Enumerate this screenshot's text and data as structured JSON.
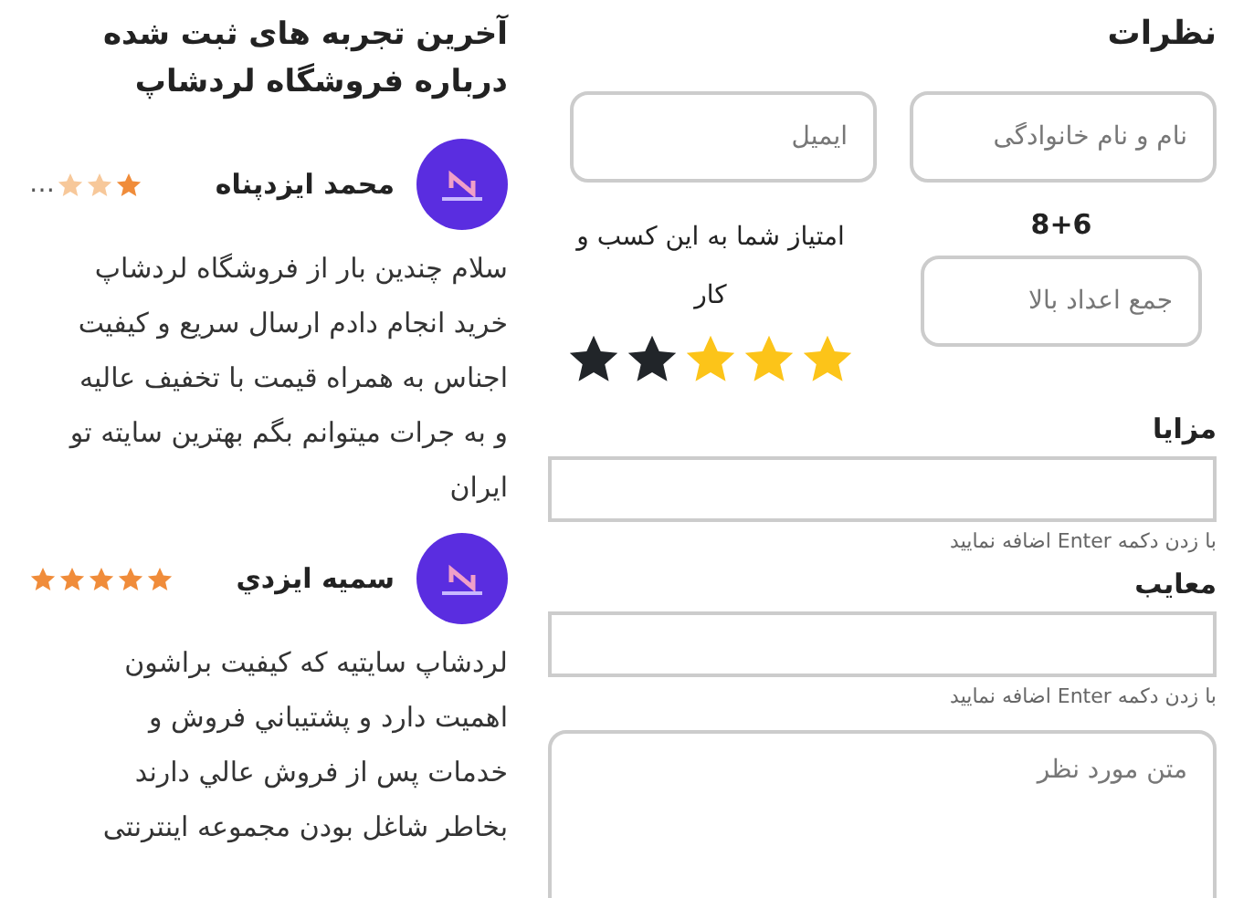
{
  "form": {
    "title": "نظرات",
    "name_field": {
      "placeholder": "نام و نام خانوادگی"
    },
    "email_field": {
      "placeholder": "ایمیل"
    },
    "captcha": {
      "question": "8+6",
      "placeholder": "جمع اعداد بالا"
    },
    "rating": {
      "label": "امتیاز شما به این کسب و کار",
      "stars": 3
    },
    "pros": {
      "label": "مزایا",
      "hint": "با زدن دکمه Enter اضافه نمایید"
    },
    "cons": {
      "label": "معایب",
      "hint": "با زدن دکمه Enter اضافه نمایید"
    },
    "comment": {
      "placeholder": "متن مورد نظر"
    }
  },
  "reviews": {
    "title": "آخرین تجربه های ثبت شده درباره فروشگاه لردشاپ",
    "items": [
      {
        "name": "محمد ایزدپناه",
        "stars": 1,
        "ellipsis": "…",
        "text": "سلام چندین بار از فروشگاه لردشاپ خرید انجام دادم ارسال سریع و کیفیت اجناس به همراه قیمت با تخفیف عالیه و به جرات میتوانم بگم بهترین سایته تو ایران"
      },
      {
        "name": "سمیه ایزدي",
        "stars": 5,
        "text": "لردشاپ سایتیه که کیفیت براشون اهمیت دارد و پشتيباني فروش و خدمات پس از فروش عالي دارند بخاطر شاغل بودن مجموعه اینترنتی"
      }
    ]
  }
}
